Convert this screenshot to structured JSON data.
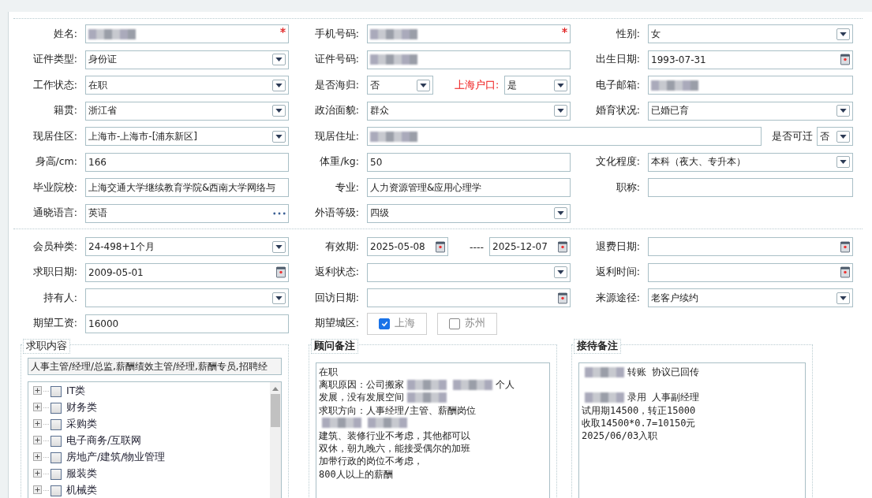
{
  "sections": [
    {
      "rows": [
        [
          {
            "label": "姓名:",
            "parts": [
              {
                "kind": "text",
                "redacted": true,
                "required": true
              }
            ]
          },
          {
            "label": "手机号码:",
            "parts": [
              {
                "kind": "text",
                "redacted": true,
                "required": true
              }
            ]
          },
          {
            "label": "性别:",
            "parts": [
              {
                "kind": "select",
                "value": "女"
              }
            ]
          }
        ],
        [
          {
            "label": "证件类型:",
            "parts": [
              {
                "kind": "select",
                "value": "身份证"
              }
            ]
          },
          {
            "label": "证件号码:",
            "parts": [
              {
                "kind": "text",
                "redacted": true
              }
            ]
          },
          {
            "label": "出生日期:",
            "parts": [
              {
                "kind": "date",
                "value": "1993-07-31"
              }
            ]
          }
        ],
        [
          {
            "label": "工作状态:",
            "parts": [
              {
                "kind": "select",
                "value": "在职"
              }
            ]
          },
          {
            "label": "是否海归:",
            "parts": [
              {
                "kind": "select",
                "value": "否"
              },
              {
                "kind": "label",
                "text": "上海户口:",
                "alert": true
              },
              {
                "kind": "select",
                "value": "是"
              }
            ]
          },
          {
            "label": "电子邮箱:",
            "parts": [
              {
                "kind": "text",
                "redacted": true
              }
            ]
          }
        ],
        [
          {
            "label": "籍贯:",
            "parts": [
              {
                "kind": "select",
                "value": "浙江省"
              }
            ]
          },
          {
            "label": "政治面貌:",
            "parts": [
              {
                "kind": "select",
                "value": "群众"
              }
            ]
          },
          {
            "label": "婚育状况:",
            "parts": [
              {
                "kind": "select",
                "value": "已婚已育"
              }
            ]
          }
        ],
        [
          {
            "label": "现居住区:",
            "parts": [
              {
                "kind": "select",
                "value": " 上海市-上海市-[浦东新区]"
              }
            ]
          },
          {
            "label": "现居住址:",
            "wide": true,
            "parts": [
              {
                "kind": "text",
                "redacted": true
              },
              {
                "kind": "label",
                "text": "是否可迁",
                "alert": false
              },
              {
                "kind": "select",
                "value": "否"
              }
            ]
          }
        ],
        [
          {
            "label": "身高/cm:",
            "parts": [
              {
                "kind": "text",
                "value": "166"
              }
            ]
          },
          {
            "label": "体重/kg:",
            "parts": [
              {
                "kind": "text",
                "value": "50"
              }
            ]
          },
          {
            "label": "文化程度:",
            "parts": [
              {
                "kind": "select",
                "value": "本科（夜大、专升本）"
              }
            ]
          }
        ],
        [
          {
            "label": "毕业院校:",
            "parts": [
              {
                "kind": "text",
                "value": "上海交通大学继续教育学院&西南大学网络与"
              }
            ]
          },
          {
            "label": "专业:",
            "parts": [
              {
                "kind": "text",
                "value": "人力资源管理&应用心理学"
              }
            ]
          },
          {
            "label": "职称:",
            "parts": [
              {
                "kind": "text"
              }
            ]
          }
        ],
        [
          {
            "label": "通晓语言:",
            "parts": [
              {
                "kind": "more",
                "value": "英语"
              }
            ]
          },
          {
            "label": "外语等级:",
            "parts": [
              {
                "kind": "select",
                "value": "四级"
              }
            ]
          }
        ]
      ]
    },
    {
      "rows": [
        [
          {
            "label": "会员种类:",
            "parts": [
              {
                "kind": "select",
                "value": " 24-498+1个月"
              }
            ]
          },
          {
            "label": "有效期:",
            "parts": [
              {
                "kind": "date",
                "value": "2025-05-08"
              },
              {
                "kind": "label",
                "text": "----",
                "alert": false
              },
              {
                "kind": "date",
                "value": "2025-12-07"
              }
            ]
          },
          {
            "label": "退费日期:",
            "parts": [
              {
                "kind": "date"
              }
            ]
          }
        ],
        [
          {
            "label": "求职日期:",
            "parts": [
              {
                "kind": "date",
                "value": "2009-05-01"
              }
            ]
          },
          {
            "label": "返利状态:",
            "parts": [
              {
                "kind": "select"
              }
            ]
          },
          {
            "label": "返利时间:",
            "parts": [
              {
                "kind": "date"
              }
            ]
          }
        ],
        [
          {
            "label": "持有人:",
            "parts": [
              {
                "kind": "select"
              }
            ]
          },
          {
            "label": "回访日期:",
            "parts": [
              {
                "kind": "date"
              }
            ]
          },
          {
            "label": "来源途径:",
            "parts": [
              {
                "kind": "select",
                "value": "老客户续约"
              }
            ]
          }
        ],
        [
          {
            "label": "期望工资:",
            "parts": [
              {
                "kind": "text",
                "value": "16000"
              }
            ]
          },
          {
            "label": "期望城区:",
            "parts": [
              {
                "kind": "checkbox",
                "text": "上海",
                "checked": true
              },
              {
                "kind": "checkbox",
                "text": "苏州",
                "checked": false
              }
            ]
          }
        ]
      ]
    }
  ],
  "panels": [
    {
      "kind": "tree",
      "title": "求职内容",
      "summary": "人事主管/经理/总监,薪酬绩效主管/经理,薪酬专员,招聘经",
      "nodes": [
        {
          "label": "IT类",
          "checked": false
        },
        {
          "label": "财务类",
          "checked": false
        },
        {
          "label": "采购类",
          "checked": false
        },
        {
          "label": "电子商务/互联网",
          "checked": false
        },
        {
          "label": "房地产/建筑/物业管理",
          "checked": false
        },
        {
          "label": "服装类",
          "checked": false
        },
        {
          "label": "机械类",
          "checked": false
        }
      ]
    },
    {
      "kind": "notes",
      "title": "顾问备注",
      "lines": [
        {
          "segments": [
            {
              "kind": "text",
              "text": "在职"
            }
          ]
        },
        {
          "segments": [
            {
              "kind": "text",
              "text": "离职原因：公司搬家 "
            },
            {
              "kind": "redacted"
            },
            {
              "kind": "redacted"
            },
            {
              "kind": "text",
              "text": " 个人"
            }
          ]
        },
        {
          "segments": [
            {
              "kind": "text",
              "text": "发展，没有发展空间 "
            },
            {
              "kind": "redacted"
            }
          ]
        },
        {
          "segments": [
            {
              "kind": "text",
              "text": "求职方向：人事经理/主管、薪酬岗位"
            }
          ]
        },
        {
          "segments": [
            {
              "kind": "redacted"
            },
            {
              "kind": "redacted"
            }
          ]
        },
        {
          "segments": [
            {
              "kind": "text",
              "text": "建筑、装修行业不考虑，其他都可以"
            }
          ]
        },
        {
          "segments": [
            {
              "kind": "text",
              "text": "双休，朝九晚六，能接受偶尔的加班"
            }
          ]
        },
        {
          "segments": [
            {
              "kind": "text",
              "text": "加带行政的岗位不考虑，"
            }
          ]
        },
        {
          "segments": [
            {
              "kind": "text",
              "text": "800人以上的薪酬"
            }
          ]
        }
      ]
    },
    {
      "kind": "notes",
      "title": "接待备注",
      "lines": [
        {
          "segments": [
            {
              "kind": "redacted"
            },
            {
              "kind": "text",
              "text": " 转账 协议已回传"
            }
          ]
        },
        {
          "spaced": true,
          "segments": [
            {
              "kind": "redacted"
            },
            {
              "kind": "text",
              "text": "录用 人事副经理"
            }
          ]
        },
        {
          "segments": [
            {
              "kind": "text",
              "text": "试用期14500，转正15000"
            }
          ]
        },
        {
          "segments": [
            {
              "kind": "text",
              "text": "收取14500*0.7=10150元"
            }
          ]
        },
        {
          "segments": [
            {
              "kind": "text",
              "text": "2025/06/03入职"
            }
          ]
        }
      ]
    }
  ]
}
